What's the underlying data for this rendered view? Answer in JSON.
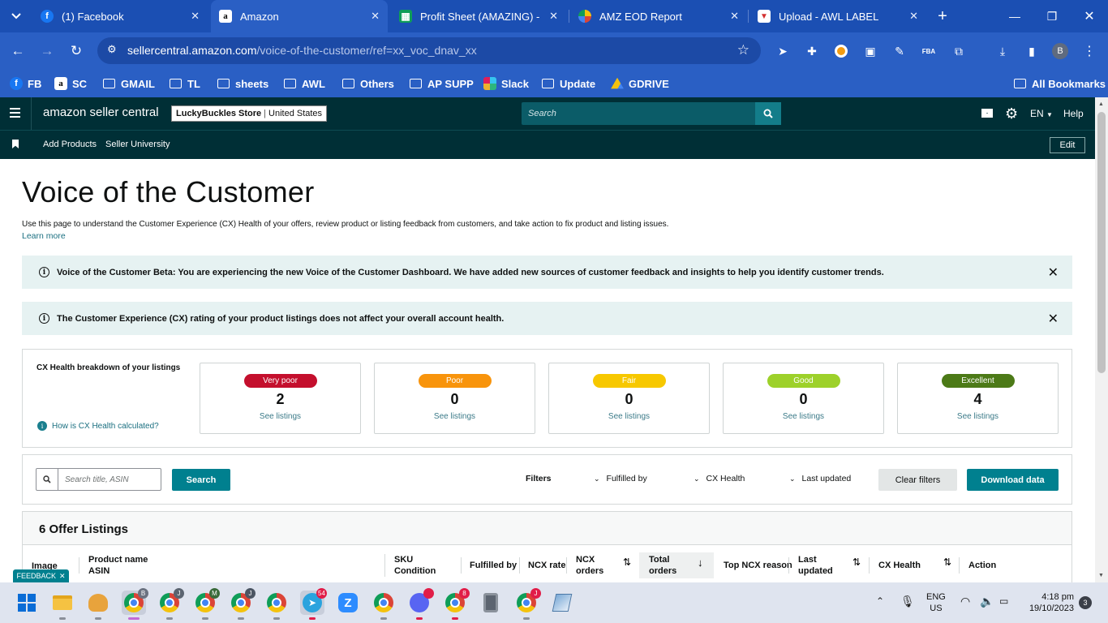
{
  "browser": {
    "tabs": [
      {
        "title": "(1) Facebook",
        "icon": "facebook-icon",
        "active": false
      },
      {
        "title": "Amazon",
        "icon": "amazon-icon",
        "active": true
      },
      {
        "title": "Profit Sheet (AMAZING) - G",
        "icon": "sheets-icon",
        "active": false
      },
      {
        "title": "AMZ EOD Report",
        "icon": "pinwheel-icon",
        "active": false
      },
      {
        "title": "Upload - AWL LABEL",
        "icon": "label-icon",
        "active": false
      }
    ],
    "url_host": "sellercentral.amazon.com",
    "url_path": "/voice-of-the-customer/ref=xx_voc_dnav_xx",
    "profile_initial": "B",
    "bookmarks": [
      {
        "label": "FB",
        "icon": "facebook-icon"
      },
      {
        "label": "SC",
        "icon": "amazon-icon"
      },
      {
        "label": "GMAIL",
        "icon": "folder-icon"
      },
      {
        "label": "TL",
        "icon": "folder-icon"
      },
      {
        "label": "sheets",
        "icon": "folder-icon"
      },
      {
        "label": "AWL",
        "icon": "folder-icon"
      },
      {
        "label": "Others",
        "icon": "folder-icon"
      },
      {
        "label": "AP SUPP",
        "icon": "folder-icon"
      },
      {
        "label": "Slack",
        "icon": "slack-icon"
      },
      {
        "label": "Update",
        "icon": "folder-icon"
      },
      {
        "label": "GDRIVE",
        "icon": "drive-icon"
      }
    ],
    "all_bookmarks": "All Bookmarks"
  },
  "seller": {
    "logo_text": "amazon seller central",
    "store_name": "LuckyBuckles Store",
    "store_region": "United States",
    "search_placeholder": "Search",
    "language": "EN",
    "help": "Help",
    "sub_nav": [
      "Add Products",
      "Seller University"
    ],
    "edit": "Edit"
  },
  "page": {
    "title": "Voice of the Customer",
    "description": "Use this page to understand the Customer Experience (CX) Health of your offers, review product or listing feedback from customers, and take action to fix product and listing issues.",
    "learn_more": "Learn more",
    "banners": [
      "Voice of the Customer Beta: You are experiencing the new Voice of the Customer Dashboard. We have added new sources of customer feedback and insights to help you identify customer trends.",
      "The Customer Experience (CX) rating of your product listings does not affect your overall account health."
    ],
    "breakdown_title": "CX Health breakdown of your listings",
    "how_calculated": "How is CX Health calculated?",
    "health_cards": [
      {
        "label": "Very poor",
        "count": "2",
        "link": "See listings",
        "color": "#c40f2d"
      },
      {
        "label": "Poor",
        "count": "0",
        "link": "See listings",
        "color": "#f8940c"
      },
      {
        "label": "Fair",
        "count": "0",
        "link": "See listings",
        "color": "#f7c800"
      },
      {
        "label": "Good",
        "count": "0",
        "link": "See listings",
        "color": "#9dd12a"
      },
      {
        "label": "Excellent",
        "count": "4",
        "link": "See listings",
        "color": "#4c7a17"
      }
    ],
    "search_placeholder": "Search title, ASIN",
    "search_button": "Search",
    "filters_label": "Filters",
    "filters": [
      "Fulfilled by",
      "CX Health",
      "Last updated"
    ],
    "clear_filters": "Clear filters",
    "download_data": "Download data",
    "listings_title": "6 Offer Listings",
    "columns": {
      "image": "Image",
      "product_name": "Product name",
      "asin": "ASIN",
      "sku": "SKU",
      "condition": "Condition",
      "fulfilled_by": "Fulfilled by",
      "ncx_rate": "NCX rate",
      "ncx_orders_1": "NCX",
      "ncx_orders_2": "orders",
      "total_orders_1": "Total",
      "total_orders_2": "orders",
      "top_ncx_reason": "Top NCX reason",
      "last_updated_1": "Last",
      "last_updated_2": "updated",
      "cx_health": "CX Health",
      "action": "Action"
    },
    "feedback": "FEEDBACK"
  },
  "taskbar": {
    "lang_1": "ENG",
    "lang_2": "US",
    "time": "4:18 pm",
    "date": "19/10/2023",
    "notification_count": "3",
    "telegram_badge": "54",
    "discord_badge": "8"
  }
}
